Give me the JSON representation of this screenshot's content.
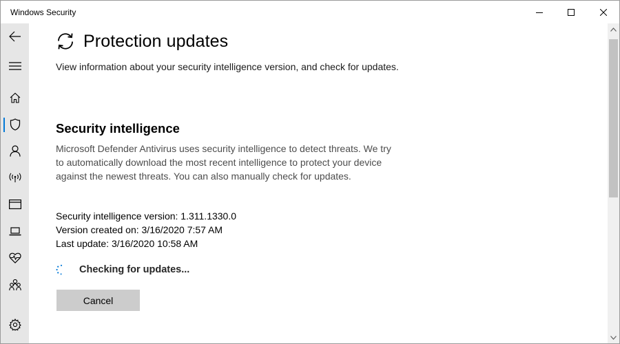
{
  "window": {
    "title": "Windows Security"
  },
  "nav": {
    "items": [
      {
        "icon": "back-arrow-icon"
      },
      {
        "icon": "hamburger-menu-icon"
      },
      {
        "icon": "home-icon"
      },
      {
        "icon": "shield-icon",
        "active": true
      },
      {
        "icon": "person-icon"
      },
      {
        "icon": "wireless-icon"
      },
      {
        "icon": "browser-window-icon"
      },
      {
        "icon": "laptop-icon"
      },
      {
        "icon": "heart-pulse-icon"
      },
      {
        "icon": "family-icon"
      },
      {
        "icon": "settings-gear-icon"
      }
    ]
  },
  "page": {
    "title": "Protection updates",
    "description": "View information about your security intelligence version, and check for updates."
  },
  "section": {
    "heading": "Security intelligence",
    "description": "Microsoft Defender Antivirus uses security intelligence to detect threats. We try to automatically download the most recent intelligence to protect your device against the newest threats. You can also manually check for updates."
  },
  "info": {
    "version": "Security intelligence version: 1.311.1330.0",
    "created": "Version created on: 3/16/2020 7:57 AM",
    "last_update": "Last update: 3/16/2020 10:58 AM"
  },
  "status": {
    "checking_label": "Checking for updates..."
  },
  "actions": {
    "cancel_label": "Cancel"
  },
  "colors": {
    "accent": "#0078d7",
    "nav_background": "#e6e6e6",
    "button_background": "#cccccc"
  }
}
